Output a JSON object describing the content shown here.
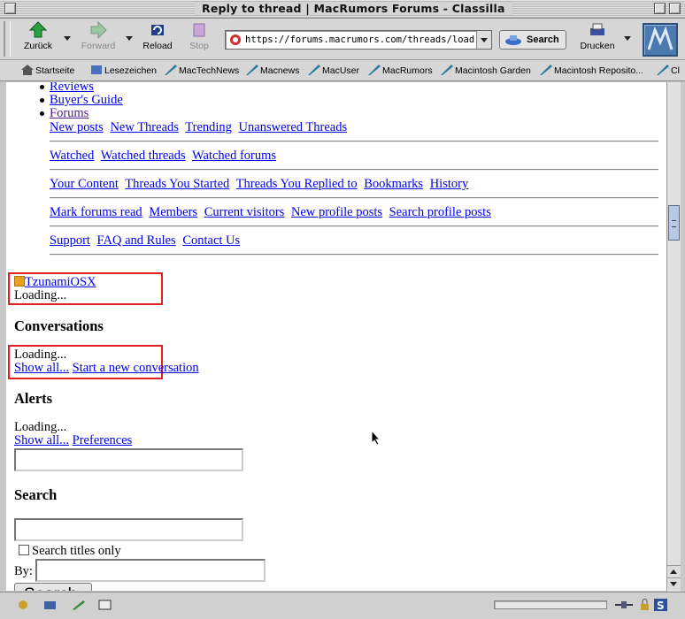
{
  "window": {
    "title": "Reply to thread | MacRumors Forums - Classilla"
  },
  "toolbar": {
    "back_label": "Zurück",
    "forward_label": "Forward",
    "reload_label": "Reload",
    "stop_label": "Stop",
    "url": "https://forums.macrumors.com/threads/load-macr",
    "search_label": "Search",
    "print_label": "Drucken"
  },
  "personal_toolbar": {
    "items": [
      "Startseite",
      "Lesezeichen",
      "MacTechNews",
      "Macnews",
      "MacUser",
      "MacRumors",
      "Macintosh Garden",
      "Macintosh Reposito...",
      "Cl"
    ]
  },
  "page": {
    "nav_items": [
      "Reviews",
      "Buyer's Guide",
      "Forums"
    ],
    "link_rows": [
      [
        "New posts",
        "New Threads",
        "Trending",
        "Unanswered Threads"
      ],
      [
        "Watched",
        "Watched threads",
        "Watched forums"
      ],
      [
        "Your Content",
        "Threads You Started",
        "Threads You Replied to",
        "Bookmarks",
        "History"
      ],
      [
        "Mark forums read",
        "Members",
        "Current visitors",
        "New profile posts",
        "Search profile posts"
      ],
      [
        "Support",
        "FAQ and Rules",
        "Contact Us"
      ]
    ],
    "username": "TzunamiOSX",
    "loading_text": "Loading...",
    "conversations": {
      "heading": "Conversations",
      "loading": "Loading...",
      "show_all": "Show all...",
      "start_new": "Start a new conversation"
    },
    "alerts": {
      "heading": "Alerts",
      "loading": "Loading...",
      "show_all": "Show all...",
      "preferences": "Preferences"
    },
    "search": {
      "heading": "Search",
      "titles_only_label": "Search titles only",
      "by_label": "By:",
      "button_label": "Search"
    }
  },
  "colors": {
    "link": "#0000ee",
    "visited": "#551a8b",
    "highlight_box": "#e02020"
  }
}
